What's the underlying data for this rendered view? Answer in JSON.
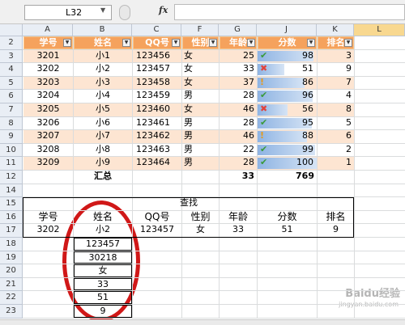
{
  "formula_bar": {
    "name_box": "L32",
    "fx_label": "fx",
    "formula_value": ""
  },
  "columns": [
    "A",
    "B",
    "C",
    "F",
    "G",
    "J",
    "K",
    "L"
  ],
  "row_numbers": [
    "2",
    "3",
    "4",
    "5",
    "6",
    "7",
    "8",
    "9",
    "10",
    "11",
    "12",
    "14",
    "15",
    "16",
    "17",
    "18",
    "19",
    "20",
    "21",
    "22",
    "23"
  ],
  "table": {
    "headers": [
      "学号",
      "姓名",
      "QQ号",
      "性别",
      "年龄",
      "分数",
      "排名"
    ],
    "rows": [
      {
        "id": "3201",
        "name": "小1",
        "qq": "123456",
        "sex": "女",
        "age": "25",
        "icon": "check",
        "score": "98",
        "rank": "3",
        "bar": 0.95
      },
      {
        "id": "3202",
        "name": "小2",
        "qq": "123457",
        "sex": "女",
        "age": "33",
        "icon": "x",
        "score": "51",
        "rank": "9",
        "bar": 0.45
      },
      {
        "id": "3203",
        "name": "小3",
        "qq": "123458",
        "sex": "女",
        "age": "37",
        "icon": "ex",
        "score": "86",
        "rank": "7",
        "bar": 0.8
      },
      {
        "id": "3204",
        "name": "小4",
        "qq": "123459",
        "sex": "男",
        "age": "28",
        "icon": "check",
        "score": "96",
        "rank": "4",
        "bar": 0.93
      },
      {
        "id": "3205",
        "name": "小5",
        "qq": "123460",
        "sex": "女",
        "age": "46",
        "icon": "x",
        "score": "56",
        "rank": "8",
        "bar": 0.5
      },
      {
        "id": "3206",
        "name": "小6",
        "qq": "123461",
        "sex": "男",
        "age": "28",
        "icon": "check",
        "score": "95",
        "rank": "5",
        "bar": 0.92
      },
      {
        "id": "3207",
        "name": "小7",
        "qq": "123462",
        "sex": "男",
        "age": "46",
        "icon": "ex",
        "score": "88",
        "rank": "6",
        "bar": 0.83
      },
      {
        "id": "3208",
        "name": "小8",
        "qq": "123463",
        "sex": "男",
        "age": "22",
        "icon": "check",
        "score": "99",
        "rank": "2",
        "bar": 0.97
      },
      {
        "id": "3209",
        "name": "小9",
        "qq": "123464",
        "sex": "男",
        "age": "28",
        "icon": "check",
        "score": "100",
        "rank": "1",
        "bar": 1.0
      }
    ],
    "total_label": "汇总",
    "total_age": "33",
    "total_score": "769"
  },
  "lookup": {
    "title": "查找",
    "headers": [
      "学号",
      "姓名",
      "QQ号",
      "性别",
      "年龄",
      "分数",
      "排名"
    ],
    "values": [
      "3202",
      "小2",
      "123457",
      "女",
      "33",
      "51",
      "9"
    ],
    "vertical": [
      "123457",
      "30218",
      "女",
      "33",
      "51",
      "9"
    ]
  },
  "colors": {
    "header": "#f5a25d",
    "band": "#fde5d2",
    "bar": "#8fb4e3",
    "annotation": "#d01818"
  },
  "watermark": {
    "line1": "Baidu经验",
    "line2": "jingyan.baidu.com"
  }
}
